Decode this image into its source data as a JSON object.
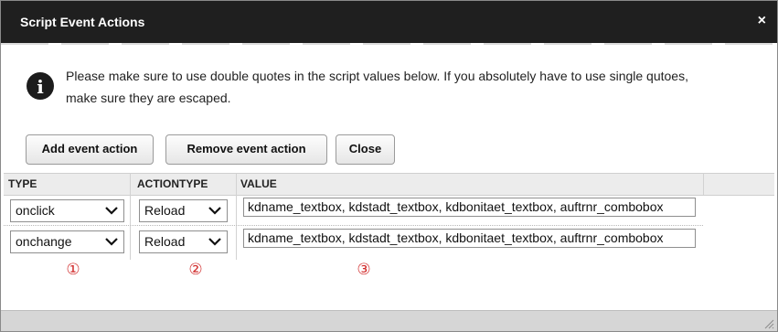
{
  "dialog": {
    "title": "Script Event Actions",
    "close_glyph": "×",
    "info_icon_glyph": "i",
    "info_line1": "Please make sure to use double quotes in the script values below. If you absolutely have to use single qutoes,",
    "info_line2": "make sure they are escaped."
  },
  "buttons": {
    "add": "Add event action",
    "remove": "Remove event action",
    "close": "Close"
  },
  "grid": {
    "headers": {
      "type": "TYPE",
      "actiontype": "ACTIONTYPE",
      "value": "VALUE"
    },
    "rows": [
      {
        "type": "onclick",
        "actiontype": "Reload",
        "value": "kdname_textbox, kdstadt_textbox, kdbonitaet_textbox, auftrnr_combobox"
      },
      {
        "type": "onchange",
        "actiontype": "Reload",
        "value": "kdname_textbox, kdstadt_textbox, kdbonitaet_textbox, auftrnr_combobox"
      }
    ]
  },
  "markers": [
    "①",
    "②",
    "③"
  ],
  "colors": {
    "titlebar": "#1f1f1f",
    "header_bg": "#ececec",
    "footer_bg": "#d6d6d6",
    "marker_red": "#d12a2a"
  },
  "icons": {
    "info": "info-icon",
    "close": "close-icon",
    "dropdown": "chevron-down-icon",
    "resize": "resize-grip-icon"
  }
}
